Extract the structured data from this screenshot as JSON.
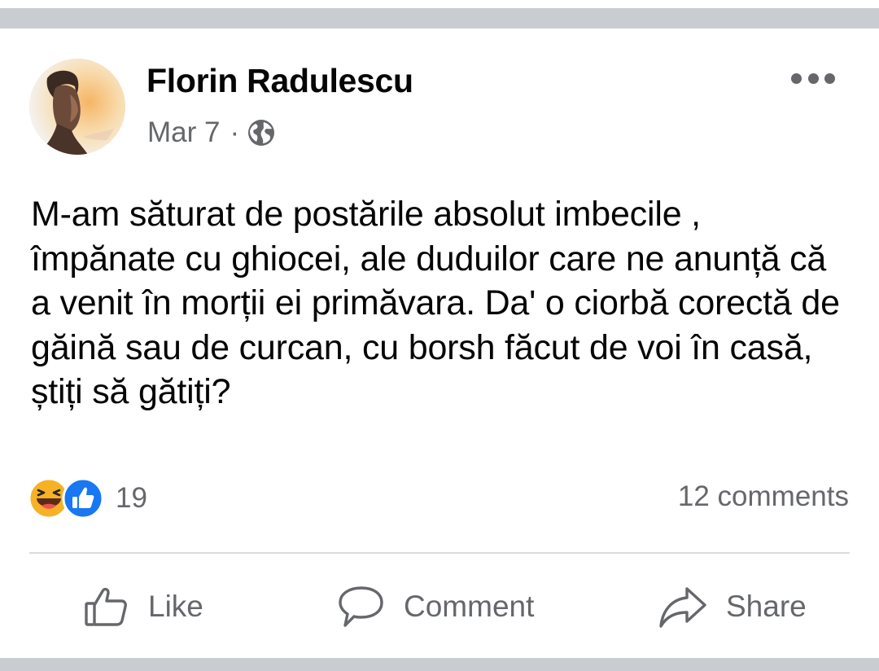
{
  "post": {
    "author": "Florin Radulescu",
    "date": "Mar 7",
    "separator": "·",
    "privacy_icon": "globe-icon",
    "text": "M-am săturat de postările absolut imbecile , împănate cu ghiocei, ale duduilor care ne anunță că a venit în morții ei primăvara. Da' o ciorbă corectă de găină sau de curcan, cu borsh făcut de voi în casă, știți să gătiți?"
  },
  "reactions": {
    "icons": [
      "laughing-emoji-icon",
      "thumbs-up-reaction-icon"
    ],
    "count": "19"
  },
  "comments_count": "12 comments",
  "actions": {
    "like": "Like",
    "comment": "Comment",
    "share": "Share"
  },
  "colors": {
    "text": "#050505",
    "secondary_text": "#65676b",
    "like_blue": "#1877f2",
    "haha_yellow": "#f7b125",
    "band_gray": "#c9ccd1"
  }
}
